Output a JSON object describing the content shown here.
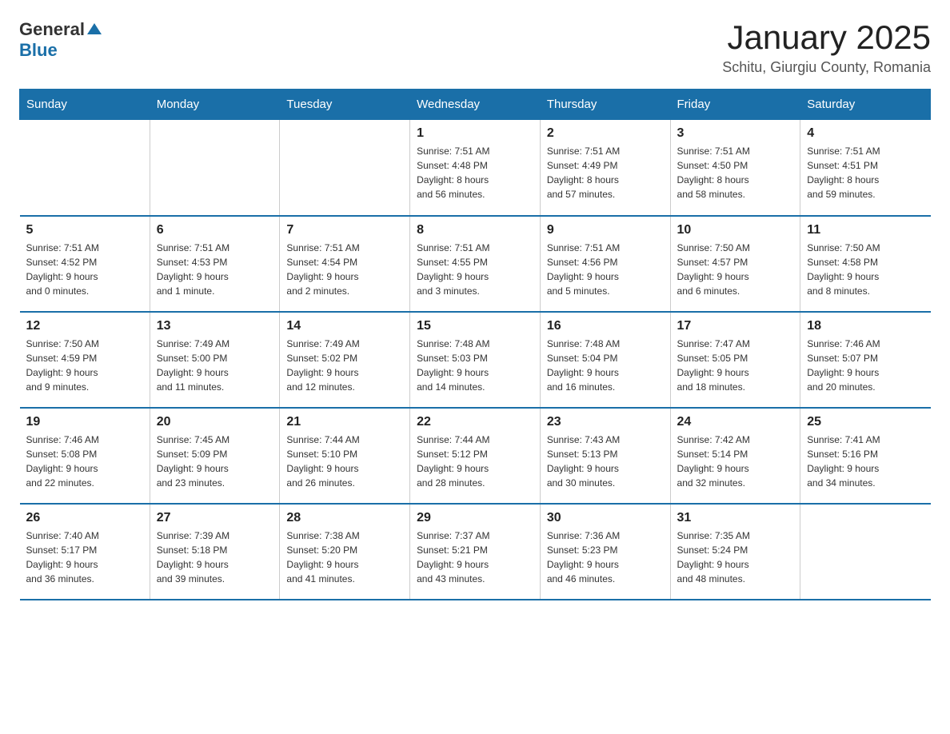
{
  "logo": {
    "text_general": "General",
    "text_blue": "Blue",
    "arrow": "▲"
  },
  "calendar": {
    "title": "January 2025",
    "subtitle": "Schitu, Giurgiu County, Romania"
  },
  "headers": [
    "Sunday",
    "Monday",
    "Tuesday",
    "Wednesday",
    "Thursday",
    "Friday",
    "Saturday"
  ],
  "weeks": [
    [
      {
        "day": "",
        "info": ""
      },
      {
        "day": "",
        "info": ""
      },
      {
        "day": "",
        "info": ""
      },
      {
        "day": "1",
        "info": "Sunrise: 7:51 AM\nSunset: 4:48 PM\nDaylight: 8 hours\nand 56 minutes."
      },
      {
        "day": "2",
        "info": "Sunrise: 7:51 AM\nSunset: 4:49 PM\nDaylight: 8 hours\nand 57 minutes."
      },
      {
        "day": "3",
        "info": "Sunrise: 7:51 AM\nSunset: 4:50 PM\nDaylight: 8 hours\nand 58 minutes."
      },
      {
        "day": "4",
        "info": "Sunrise: 7:51 AM\nSunset: 4:51 PM\nDaylight: 8 hours\nand 59 minutes."
      }
    ],
    [
      {
        "day": "5",
        "info": "Sunrise: 7:51 AM\nSunset: 4:52 PM\nDaylight: 9 hours\nand 0 minutes."
      },
      {
        "day": "6",
        "info": "Sunrise: 7:51 AM\nSunset: 4:53 PM\nDaylight: 9 hours\nand 1 minute."
      },
      {
        "day": "7",
        "info": "Sunrise: 7:51 AM\nSunset: 4:54 PM\nDaylight: 9 hours\nand 2 minutes."
      },
      {
        "day": "8",
        "info": "Sunrise: 7:51 AM\nSunset: 4:55 PM\nDaylight: 9 hours\nand 3 minutes."
      },
      {
        "day": "9",
        "info": "Sunrise: 7:51 AM\nSunset: 4:56 PM\nDaylight: 9 hours\nand 5 minutes."
      },
      {
        "day": "10",
        "info": "Sunrise: 7:50 AM\nSunset: 4:57 PM\nDaylight: 9 hours\nand 6 minutes."
      },
      {
        "day": "11",
        "info": "Sunrise: 7:50 AM\nSunset: 4:58 PM\nDaylight: 9 hours\nand 8 minutes."
      }
    ],
    [
      {
        "day": "12",
        "info": "Sunrise: 7:50 AM\nSunset: 4:59 PM\nDaylight: 9 hours\nand 9 minutes."
      },
      {
        "day": "13",
        "info": "Sunrise: 7:49 AM\nSunset: 5:00 PM\nDaylight: 9 hours\nand 11 minutes."
      },
      {
        "day": "14",
        "info": "Sunrise: 7:49 AM\nSunset: 5:02 PM\nDaylight: 9 hours\nand 12 minutes."
      },
      {
        "day": "15",
        "info": "Sunrise: 7:48 AM\nSunset: 5:03 PM\nDaylight: 9 hours\nand 14 minutes."
      },
      {
        "day": "16",
        "info": "Sunrise: 7:48 AM\nSunset: 5:04 PM\nDaylight: 9 hours\nand 16 minutes."
      },
      {
        "day": "17",
        "info": "Sunrise: 7:47 AM\nSunset: 5:05 PM\nDaylight: 9 hours\nand 18 minutes."
      },
      {
        "day": "18",
        "info": "Sunrise: 7:46 AM\nSunset: 5:07 PM\nDaylight: 9 hours\nand 20 minutes."
      }
    ],
    [
      {
        "day": "19",
        "info": "Sunrise: 7:46 AM\nSunset: 5:08 PM\nDaylight: 9 hours\nand 22 minutes."
      },
      {
        "day": "20",
        "info": "Sunrise: 7:45 AM\nSunset: 5:09 PM\nDaylight: 9 hours\nand 23 minutes."
      },
      {
        "day": "21",
        "info": "Sunrise: 7:44 AM\nSunset: 5:10 PM\nDaylight: 9 hours\nand 26 minutes."
      },
      {
        "day": "22",
        "info": "Sunrise: 7:44 AM\nSunset: 5:12 PM\nDaylight: 9 hours\nand 28 minutes."
      },
      {
        "day": "23",
        "info": "Sunrise: 7:43 AM\nSunset: 5:13 PM\nDaylight: 9 hours\nand 30 minutes."
      },
      {
        "day": "24",
        "info": "Sunrise: 7:42 AM\nSunset: 5:14 PM\nDaylight: 9 hours\nand 32 minutes."
      },
      {
        "day": "25",
        "info": "Sunrise: 7:41 AM\nSunset: 5:16 PM\nDaylight: 9 hours\nand 34 minutes."
      }
    ],
    [
      {
        "day": "26",
        "info": "Sunrise: 7:40 AM\nSunset: 5:17 PM\nDaylight: 9 hours\nand 36 minutes."
      },
      {
        "day": "27",
        "info": "Sunrise: 7:39 AM\nSunset: 5:18 PM\nDaylight: 9 hours\nand 39 minutes."
      },
      {
        "day": "28",
        "info": "Sunrise: 7:38 AM\nSunset: 5:20 PM\nDaylight: 9 hours\nand 41 minutes."
      },
      {
        "day": "29",
        "info": "Sunrise: 7:37 AM\nSunset: 5:21 PM\nDaylight: 9 hours\nand 43 minutes."
      },
      {
        "day": "30",
        "info": "Sunrise: 7:36 AM\nSunset: 5:23 PM\nDaylight: 9 hours\nand 46 minutes."
      },
      {
        "day": "31",
        "info": "Sunrise: 7:35 AM\nSunset: 5:24 PM\nDaylight: 9 hours\nand 48 minutes."
      },
      {
        "day": "",
        "info": ""
      }
    ]
  ]
}
